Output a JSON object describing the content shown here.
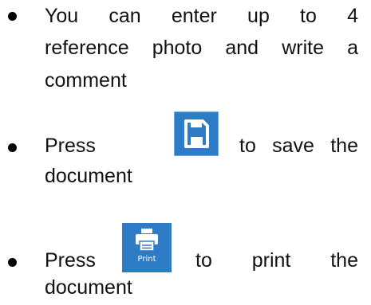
{
  "bullets": [
    {
      "lines": [
        "You",
        "can",
        "enter",
        "up",
        "to",
        "4"
      ],
      "line2": [
        "reference",
        "photo",
        "and",
        "write",
        "a"
      ],
      "line3": "comment"
    },
    {
      "before": "Press",
      "after": [
        "to",
        "save",
        "the"
      ],
      "line2": "document",
      "icon": "save-icon"
    },
    {
      "before": "Press",
      "after": [
        "to",
        "print",
        "the"
      ],
      "line2": "document",
      "icon": "print-icon",
      "icon_label": "Print"
    }
  ],
  "colors": {
    "button_blue": "#2e7bc6",
    "icon_white": "#ffffff"
  }
}
